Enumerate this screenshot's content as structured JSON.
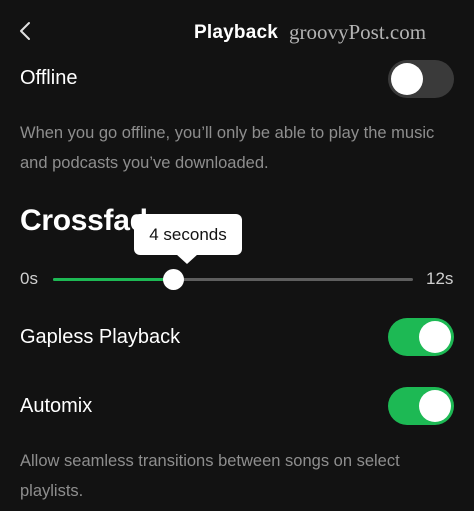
{
  "header": {
    "back_icon": "chevron-left-icon",
    "title": "Playback",
    "watermark": "groovyPost.com"
  },
  "offline": {
    "label": "Offline",
    "enabled": false,
    "description": "When you go offline, you’ll only be able to play the music and podcasts you’ve downloaded."
  },
  "crossfade": {
    "heading": "Crossfade",
    "tooltip": "4 seconds",
    "value_seconds": 4,
    "min_label": "0s",
    "max_label": "12s",
    "min": 0,
    "max": 12
  },
  "gapless": {
    "label": "Gapless Playback",
    "enabled": true
  },
  "automix": {
    "label": "Automix",
    "enabled": true,
    "description": "Allow seamless transitions between songs on select playlists."
  },
  "colors": {
    "background": "#121212",
    "accent": "#1db954",
    "toggle_off": "#3a3a3a",
    "secondary_text": "#8e8e8e"
  }
}
